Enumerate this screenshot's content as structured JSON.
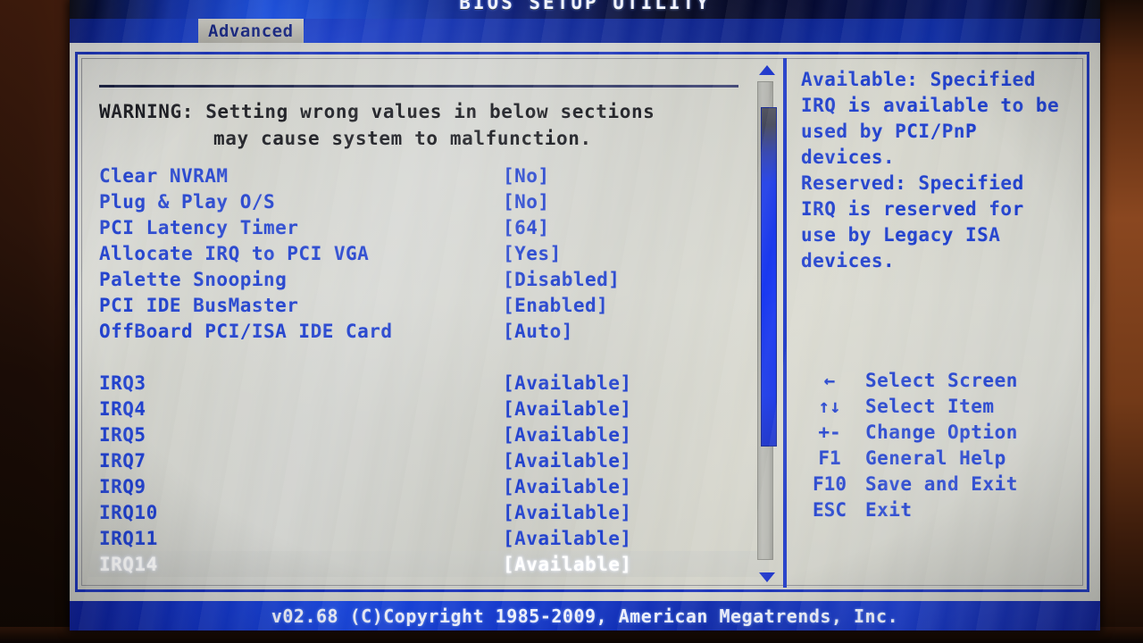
{
  "window": {
    "title": "BIOS SETUP UTILITY",
    "footer": "v02.68 (C)Copyright 1985-2009, American Megatrends, Inc."
  },
  "tabs": [
    {
      "label": "Advanced",
      "selected": true
    }
  ],
  "warning": {
    "line1": "WARNING: Setting wrong values in below sections",
    "line2": "may cause system to malfunction."
  },
  "settings": [
    {
      "label": "Clear NVRAM",
      "value": "[No]"
    },
    {
      "label": "Plug & Play O/S",
      "value": "[No]"
    },
    {
      "label": "PCI Latency Timer",
      "value": "[64]"
    },
    {
      "label": "Allocate IRQ to PCI VGA",
      "value": "[Yes]"
    },
    {
      "label": "Palette Snooping",
      "value": "[Disabled]"
    },
    {
      "label": "PCI IDE BusMaster",
      "value": "[Enabled]"
    },
    {
      "label": "OffBoard PCI/ISA IDE Card",
      "value": "[Auto]"
    }
  ],
  "irqs": [
    {
      "label": "IRQ3",
      "value": "[Available]",
      "selected": false
    },
    {
      "label": "IRQ4",
      "value": "[Available]",
      "selected": false
    },
    {
      "label": "IRQ5",
      "value": "[Available]",
      "selected": false
    },
    {
      "label": "IRQ7",
      "value": "[Available]",
      "selected": false
    },
    {
      "label": "IRQ9",
      "value": "[Available]",
      "selected": false
    },
    {
      "label": "IRQ10",
      "value": "[Available]",
      "selected": false
    },
    {
      "label": "IRQ11",
      "value": "[Available]",
      "selected": false
    },
    {
      "label": "IRQ14",
      "value": "[Available]",
      "selected": true
    }
  ],
  "scrollbar": {
    "up_arrow": "scroll-up-arrow",
    "down_arrow": "scroll-down-arrow"
  },
  "help": {
    "lines": [
      "Available: Specified",
      "IRQ is available to be",
      "used by PCI/PnP",
      "devices.",
      "Reserved: Specified",
      "IRQ is reserved for",
      "use by Legacy ISA",
      "devices."
    ]
  },
  "keys": [
    {
      "cap": "←",
      "desc": "Select Screen"
    },
    {
      "cap": "↑↓",
      "desc": "Select Item"
    },
    {
      "cap": "+-",
      "desc": "Change Option"
    },
    {
      "cap": "F1",
      "desc": "General Help"
    },
    {
      "cap": "F10",
      "desc": "Save and Exit"
    },
    {
      "cap": "ESC",
      "desc": "Exit"
    }
  ],
  "colors": {
    "accent_blue": "#1e3ecb",
    "bar_blue": "#1233c4",
    "panel_bg": "#cbccc5",
    "warning_text": "#111217",
    "selected_text": "#ffffff"
  }
}
